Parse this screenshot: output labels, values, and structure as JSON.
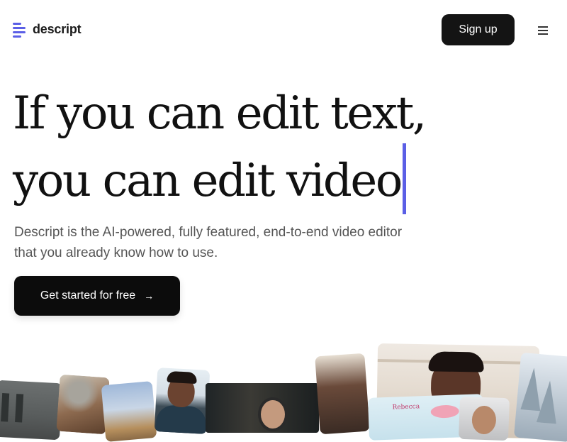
{
  "brand": {
    "name": "descript",
    "accent": "#5b5fe6"
  },
  "header": {
    "signup_label": "Sign up",
    "menu_icon": "hamburger-menu-icon"
  },
  "hero": {
    "headline_line1": "If you can edit text,",
    "headline_line2": "you can edit video",
    "subhead_line1": "Descript is the AI-powered, fully featured, end-to-end video editor",
    "subhead_line2": "that you already know how to use.",
    "cta_label": "Get started for free",
    "cta_icon": "arrow-right-icon",
    "cta_arrow": "→"
  },
  "thumbnails": {
    "sticker_text": "Rebecca"
  }
}
